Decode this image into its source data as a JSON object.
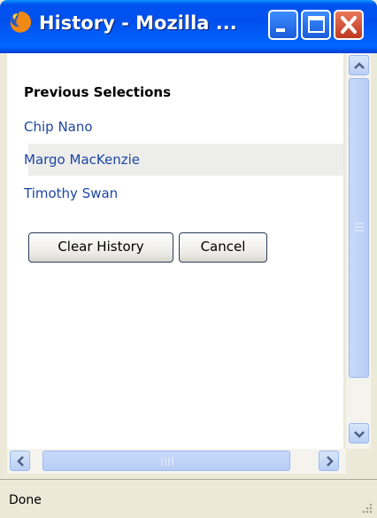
{
  "window": {
    "title": "History - Mozilla ...",
    "controls": [
      "minimize",
      "maximize",
      "close"
    ]
  },
  "history": {
    "heading": "Previous Selections",
    "items": [
      "Chip Nano",
      "Margo MacKenzie",
      "Timothy Swan"
    ],
    "highlighted_index": 1
  },
  "buttons": {
    "clear_label": "Clear History",
    "cancel_label": "Cancel"
  },
  "statusbar": {
    "text": "Done"
  },
  "icons": [
    "firefox-icon",
    "minimize-icon",
    "maximize-icon",
    "close-icon",
    "scroll-up-icon",
    "scroll-down-icon",
    "scroll-left-icon",
    "scroll-right-icon",
    "resize-grip-icon"
  ]
}
